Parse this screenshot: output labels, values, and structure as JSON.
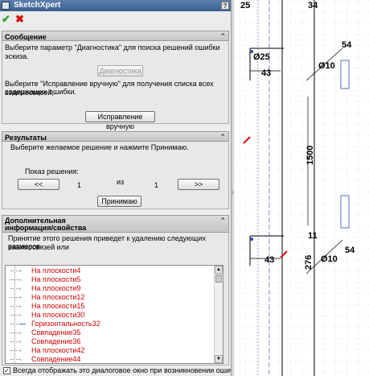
{
  "window": {
    "title": "SketchXpert",
    "help_label": "?"
  },
  "actions": {
    "ok_icon": "check-icon",
    "cancel_icon": "x-icon",
    "ok_color": "#2aa02a",
    "cancel_color": "#d01010"
  },
  "message_section": {
    "title": "Сообщение",
    "text1": "Выберите параметр \"Диагностика\" для поиска решений ошибки эскиза.",
    "diagnose_button": "Диагностика",
    "text2a": "Выберите \"Исправление вручную\" для получения списка всех взаимосвязей,",
    "text2b": "содержащих ошибки.",
    "manual_fix_button": "Исправление вручную"
  },
  "results_section": {
    "title": "Результаты",
    "instruction": "Выберите желаемое решение и нажмите Принимаю.",
    "show_solution_label": "Показ решения:",
    "prev_button": "<<",
    "current": "1",
    "of_label": "из",
    "total": "1",
    "next_button": ">>",
    "accept_button": "Принимаю"
  },
  "info_section": {
    "title_line1": "Дополнительная",
    "title_line2": "информация/свойства",
    "text_line1": "Принятие этого решения приведет к удалению следующих взаимосвязей или",
    "text_line2": "размеров",
    "items": [
      "На плоскости4",
      "На плоскости5",
      "На плоскости9",
      "На плоскости12",
      "На плоскости15",
      "На плоскости30",
      "Горизонтальность32",
      "Совпадение35",
      "Совпадение36",
      "На плоскости42",
      "Совпадение44"
    ]
  },
  "footer": {
    "checked": true,
    "label": "Всегда отображать это диалоговое окно при возникновении ошибки"
  },
  "drawing": {
    "dims": [
      "25",
      "34",
      "43",
      "Ø25",
      "Ø10",
      "54",
      "1500",
      "11",
      "276",
      "43",
      "Ø10",
      "54"
    ]
  }
}
